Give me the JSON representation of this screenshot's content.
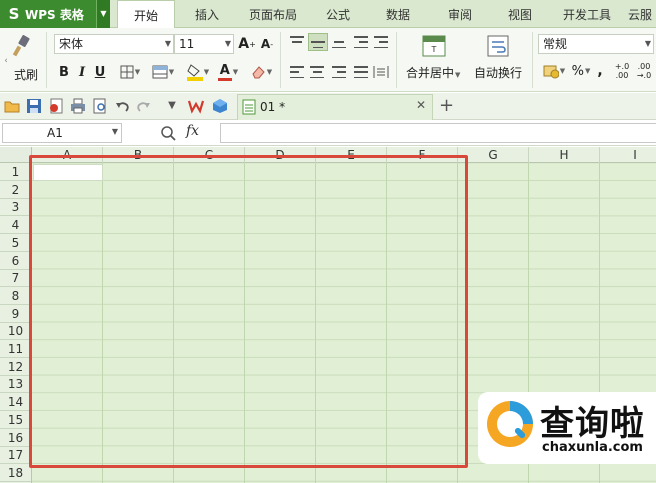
{
  "app": {
    "title": "WPS 表格",
    "logo": "S"
  },
  "menu_tabs": [
    {
      "label": "开始",
      "active": true
    },
    {
      "label": "插入",
      "active": false
    },
    {
      "label": "页面布局",
      "active": false
    },
    {
      "label": "公式",
      "active": false
    },
    {
      "label": "数据",
      "active": false
    },
    {
      "label": "审阅",
      "active": false
    },
    {
      "label": "视图",
      "active": false
    },
    {
      "label": "开发工具",
      "active": false
    },
    {
      "label": "云服"
    }
  ],
  "ribbon": {
    "format_painter_label": "式刷",
    "font_name": "宋体",
    "font_size": "11",
    "merge_center_label": "合并居中",
    "wrap_text_label": "自动换行",
    "number_format": "常规",
    "bold": "B",
    "italic": "I",
    "underline": "U",
    "font_color_letter": "A",
    "grow_font": "A",
    "shrink_font": "A",
    "thousands_sep": ",",
    "inc_decimal": ".0\n.00",
    "dec_decimal": ".00\n.0",
    "accent_color": "#d33a2c",
    "fill_color": "#f2d000"
  },
  "quick_access": {
    "doc_tab_label": "01 *"
  },
  "formula_bar": {
    "cell_ref": "A1",
    "fx_label": "fx",
    "formula": ""
  },
  "sheet": {
    "columns": [
      "A",
      "B",
      "C",
      "D",
      "E",
      "F",
      "G",
      "H",
      "I"
    ],
    "rows": [
      "1",
      "2",
      "3",
      "4",
      "5",
      "6",
      "7",
      "8",
      "9",
      "10",
      "11",
      "12",
      "13",
      "14",
      "15",
      "16",
      "17",
      "18"
    ],
    "selected_cell": "A1",
    "cell_fill": "#e1f0d4",
    "highlight_color": "#d8483b"
  },
  "watermark": {
    "title": "查询啦",
    "url": "chaxunla.com"
  }
}
